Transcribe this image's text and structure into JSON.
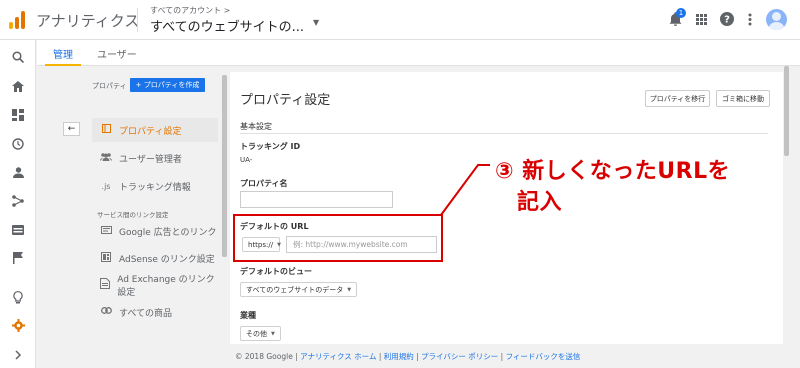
{
  "topbar": {
    "app_title": "アナリティクス",
    "account_breadcrumb": "すべてのアカウント >",
    "account_name": "すべてのウェブサイトの...",
    "notification_count": "1",
    "icons": [
      "notifications-icon",
      "apps-grid-icon",
      "help-icon",
      "more-vert-icon",
      "avatar"
    ]
  },
  "rail": {
    "icons": [
      "search-icon",
      "home-icon",
      "customization-icon",
      "clock-icon",
      "person-icon",
      "acquisition-icon",
      "behavior-icon",
      "flag-icon",
      "lightbulb-icon",
      "gear-icon",
      "chevron-right-icon"
    ]
  },
  "tabs": [
    {
      "label": "管理",
      "active": true
    },
    {
      "label": "ユーザー",
      "active": false
    }
  ],
  "property_column": {
    "label": "プロパティ",
    "create_button": "+ プロパティを作成",
    "back_arrow": "←",
    "items": [
      {
        "label": "プロパティ設定",
        "icon": "settings-page-icon",
        "active": true
      },
      {
        "label": "ユーザー管理者",
        "icon": "users-icon",
        "active": false
      },
      {
        "label": "トラッキング情報",
        "icon": "js-icon",
        "icon_text": ".js",
        "active": false
      }
    ],
    "section_label": "サービス間のリンク設定",
    "link_items": [
      {
        "label": "Google 広告とのリンク",
        "icon": "ads-icon"
      },
      {
        "label": "AdSense のリンク設定",
        "icon": "adsense-icon"
      },
      {
        "label": "Ad Exchange のリンク設定",
        "icon": "adexchange-icon"
      },
      {
        "label": "すべての商品",
        "icon": "link-icon"
      }
    ]
  },
  "main": {
    "title": "プロパティ設定",
    "move_button": "プロパティを移行",
    "trash_button": "ゴミ箱に移動",
    "section_basic": "基本設定",
    "tracking_id_label": "トラッキング ID",
    "tracking_id_value": "UA-",
    "property_name_label": "プロパティ名",
    "property_name_value": "",
    "default_url_label": "デフォルトの URL",
    "protocol_value": "https://",
    "url_placeholder": "例: http://www.mywebsite.com",
    "default_view_label": "デフォルトのビュー",
    "default_view_value": "すべてのウェブサイトのデータ",
    "industry_label": "業種",
    "industry_value": "その他"
  },
  "annotation": {
    "line1": "③ 新しくなったURLを",
    "line2": "記入",
    "color": "#d90000"
  },
  "footer": {
    "copyright": "© 2018 Google | ",
    "links": [
      "アナリティクス ホーム",
      "利用規約",
      "プライバシー ポリシー",
      "フィードバックを送信"
    ],
    "separator": " | "
  },
  "colors": {
    "accent_blue": "#1a73e8",
    "active_orange": "#e37400",
    "annotation_red": "#d90000"
  }
}
